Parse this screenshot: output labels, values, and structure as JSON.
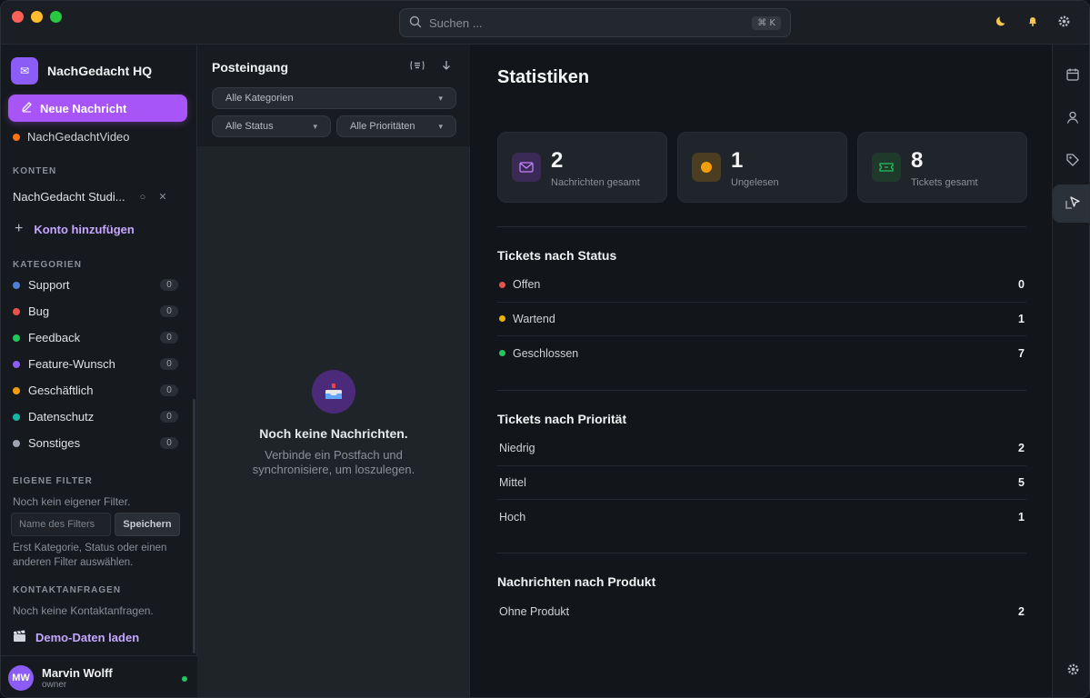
{
  "search": {
    "placeholder": "Suchen ...",
    "shortcut": "⌘ K"
  },
  "org": {
    "name": "NachGedacht HQ"
  },
  "sidebar": {
    "new_message": "Neue Nachricht",
    "partial_item": "NachGedachtVideo",
    "accounts_title": "KONTEN",
    "account_name": "NachGedacht Studi...",
    "add_account": "Konto hinzufügen",
    "categories_title": "KATEGORIEN",
    "categories": [
      {
        "label": "Support",
        "count": "0",
        "color": "#4f7fd6"
      },
      {
        "label": "Bug",
        "count": "0",
        "color": "#e5534b"
      },
      {
        "label": "Feedback",
        "count": "0",
        "color": "#22c55e"
      },
      {
        "label": "Feature-Wunsch",
        "count": "0",
        "color": "#8b5cf6"
      },
      {
        "label": "Geschäftlich",
        "count": "0",
        "color": "#f59e0b"
      },
      {
        "label": "Datenschutz",
        "count": "0",
        "color": "#14b8a6"
      },
      {
        "label": "Sonstiges",
        "count": "0",
        "color": "#9ca3af"
      }
    ],
    "own_filters_title": "EIGENE FILTER",
    "no_filter": "Noch kein eigener Filter.",
    "filter_placeholder": "Name des Filters",
    "save_label": "Speichern",
    "filter_hint": "Erst Kategorie, Status oder einen anderen Filter auswählen.",
    "contact_title": "KONTAKTANFRAGEN",
    "no_contact": "Noch keine Kontaktanfragen.",
    "demo_data": "Demo-Daten laden"
  },
  "user": {
    "initials": "MW",
    "name": "Marvin Wolff",
    "role": "owner"
  },
  "inbox": {
    "title": "Posteingang",
    "category_filter": "Alle Kategorien",
    "status_filter": "Alle Status",
    "priority_filter": "Alle Prioritäten",
    "empty_title": "Noch keine Nachrichten.",
    "empty_desc": "Verbinde ein Postfach und synchronisiere, um loszulegen."
  },
  "stats": {
    "title": "Statistiken",
    "cards": [
      {
        "value": "2",
        "label": "Nachrichten gesamt",
        "color": "#a855f7"
      },
      {
        "value": "1",
        "label": "Ungelesen",
        "color": "#f59e0b"
      },
      {
        "value": "8",
        "label": "Tickets gesamt",
        "color": "#22c55e"
      }
    ],
    "status": {
      "title": "Tickets nach Status",
      "rows": [
        {
          "label": "Offen",
          "value": "0",
          "color": "#e5534b"
        },
        {
          "label": "Wartend",
          "value": "1",
          "color": "#eab308"
        },
        {
          "label": "Geschlossen",
          "value": "7",
          "color": "#22c55e"
        }
      ]
    },
    "priority": {
      "title": "Tickets nach Priorität",
      "rows": [
        {
          "label": "Niedrig",
          "value": "2"
        },
        {
          "label": "Mittel",
          "value": "5"
        },
        {
          "label": "Hoch",
          "value": "1"
        }
      ]
    },
    "product": {
      "title": "Nachrichten nach Produkt",
      "rows": [
        {
          "label": "Ohne Produkt",
          "value": "2"
        }
      ]
    }
  }
}
